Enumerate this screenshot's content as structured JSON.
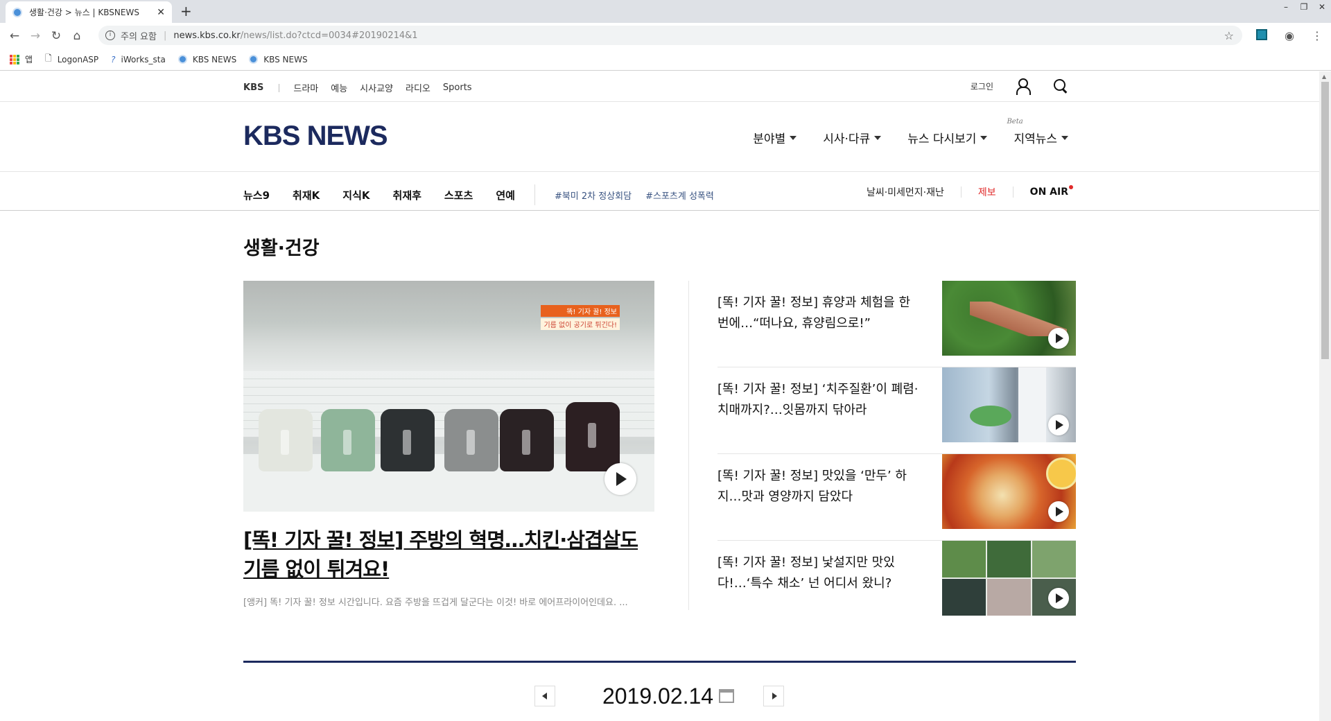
{
  "browser": {
    "tab_title": "생활·건강 > 뉴스 | KBSNEWS",
    "address_warning": "주의 요함",
    "address_host": "news.kbs.co.kr",
    "address_path": "/news/list.do?ctcd=0034#20190214&1",
    "bookmarks": [
      "앱",
      "LogonASP",
      "iWorks_sta",
      "KBS NEWS",
      "KBS NEWS"
    ]
  },
  "gnb": {
    "brand": "KBS",
    "links": [
      "드라마",
      "예능",
      "시사교양",
      "라디오",
      "Sports"
    ],
    "login": "로그인"
  },
  "header": {
    "logo": "KBS NEWS",
    "menu": [
      "분야별",
      "시사·다큐",
      "뉴스 다시보기",
      "지역뉴스"
    ],
    "beta": "Beta"
  },
  "subnav": {
    "links": [
      "뉴스9",
      "취재K",
      "지식K",
      "취재후",
      "스포츠",
      "연예"
    ],
    "tags": [
      "#북미 2차 정상회담",
      "#스포츠계 성폭력"
    ],
    "weather": "날씨·미세먼지·재난",
    "report": "제보",
    "onair": "ON AIR"
  },
  "section": {
    "title": "생활·건강"
  },
  "main_article": {
    "caption_line1": "똑! 기자 꿀! 정보",
    "caption_line2": "기름 없이 공기로 튀긴다!",
    "headline": "[똑! 기자 꿀! 정보] 주방의 혁명…치킨·삼겹살도 기름 없이 튀겨요!",
    "lead": "[앵커] 똑! 기자 꿀! 정보 시간입니다. 요즘 주방을 뜨겁게 달군다는 이것! 바로 에어프라이어인데요. ..."
  },
  "side_articles": [
    {
      "title": "[똑! 기자 꿀! 정보] 휴양과 체험을 한 번에…“떠나요, 휴양림으로!”"
    },
    {
      "title": "[똑! 기자 꿀! 정보] ‘치주질환’이 폐렴·치매까지?…잇몸까지 닦아라"
    },
    {
      "title": "[똑! 기자 꿀! 정보] 맛있을 ‘만두’ 하지…맛과 영양까지 담았다"
    },
    {
      "title": "[똑! 기자 꿀! 정보] 낯설지만 맛있다!…‘특수 채소’ 넌 어디서 왔니?"
    }
  ],
  "date_nav": {
    "date": "2019.02.14"
  },
  "colors": {
    "brand_navy": "#1c2a5e",
    "report_red": "#e02a2a",
    "tag_blue": "#3a5482"
  }
}
